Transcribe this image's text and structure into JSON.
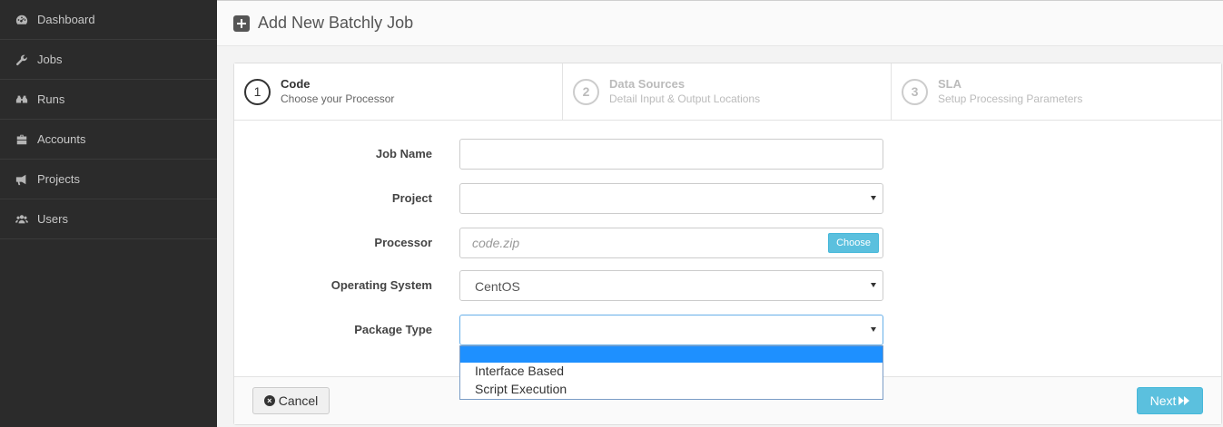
{
  "sidebar": {
    "items": [
      {
        "label": "Dashboard",
        "icon": "dashboard-icon"
      },
      {
        "label": "Jobs",
        "icon": "wrench-icon"
      },
      {
        "label": "Runs",
        "icon": "binoculars-icon"
      },
      {
        "label": "Accounts",
        "icon": "briefcase-icon"
      },
      {
        "label": "Projects",
        "icon": "bullhorn-icon"
      },
      {
        "label": "Users",
        "icon": "users-icon"
      }
    ]
  },
  "header": {
    "title": "Add New Batchly Job",
    "icon": "plus-square-icon"
  },
  "wizard": {
    "steps": [
      {
        "num": "1",
        "title": "Code",
        "subtitle": "Choose your Processor",
        "active": true
      },
      {
        "num": "2",
        "title": "Data Sources",
        "subtitle": "Detail Input & Output Locations",
        "active": false
      },
      {
        "num": "3",
        "title": "SLA",
        "subtitle": "Setup Processing Parameters",
        "active": false
      }
    ]
  },
  "form": {
    "job_name": {
      "label": "Job Name",
      "value": ""
    },
    "project": {
      "label": "Project",
      "value": ""
    },
    "processor": {
      "label": "Processor",
      "placeholder": "code.zip",
      "button": "Choose"
    },
    "os": {
      "label": "Operating System",
      "value": "CentOS"
    },
    "package_type": {
      "label": "Package Type",
      "value": "",
      "options": [
        "",
        "Interface Based",
        "Script Execution"
      ]
    }
  },
  "footer": {
    "cancel_label": "Cancel",
    "next_label": "Next"
  },
  "colors": {
    "sidebar_bg": "#2b2b2b",
    "accent": "#5bc0de",
    "dropdown_highlight": "#1e90ff"
  }
}
